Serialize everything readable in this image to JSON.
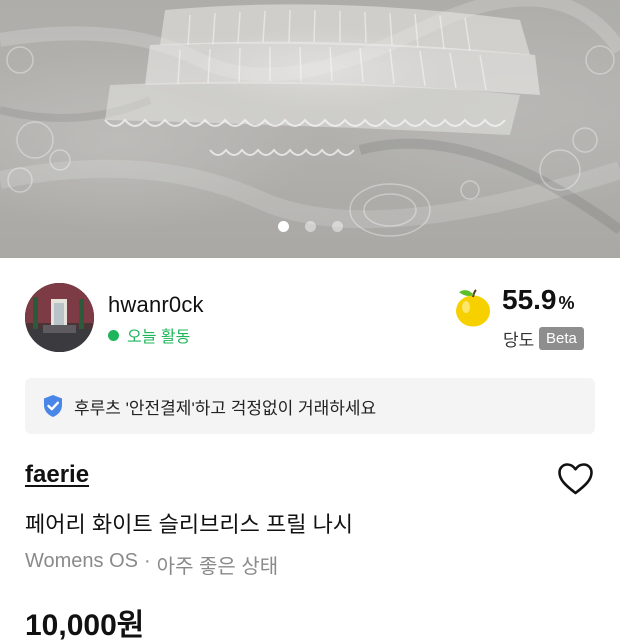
{
  "listing": {
    "carousel": {
      "slide_count": 3,
      "active_index": 0
    },
    "seller": {
      "name": "hwanr0ck",
      "activity": "오늘 활동",
      "activity_color": "#1fb65b",
      "sweetness": {
        "value": "55.9",
        "unit": "%",
        "label": "당도",
        "badge": "Beta",
        "icon": "yellow-apple-icon"
      }
    },
    "safe_payment": {
      "icon": "shield-check-icon",
      "text": "후루츠 '안전결제'하고 걱정없이 거래하세요"
    },
    "product": {
      "brand": "faerie",
      "title": "페어리 화이트 슬리브리스 프릴 나시",
      "size": "Womens OS",
      "separator": "·",
      "condition": "아주 좋은 상태",
      "price": "10,000원",
      "like_icon": "heart-outline-icon"
    }
  }
}
